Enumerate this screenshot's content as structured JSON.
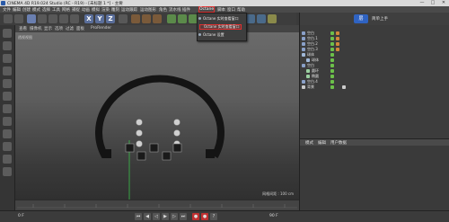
{
  "window": {
    "title": "CINEMA 4D R19.024 Studio (RC - R19) - [未标题 1 *] - 主要",
    "buttons": [
      "—",
      "□",
      "✕"
    ]
  },
  "menubar": {
    "items": [
      "文件",
      "编辑",
      "创建",
      "模式",
      "选择",
      "工具",
      "网格",
      "捕捉",
      "动画",
      "模拟",
      "渲染",
      "雕刻",
      "运动跟踪",
      "运动图形",
      "角色",
      "流水线",
      "插件",
      "Octane",
      "脚本",
      "窗口",
      "帮助"
    ]
  },
  "toolbar": {
    "xyz": [
      "X",
      "Y",
      "Z"
    ]
  },
  "dropdown": {
    "items": [
      "Octane 实时查看窗口",
      "Octane 实时查看窗口",
      "Octane 设置"
    ]
  },
  "viewport": {
    "menu": [
      "查看",
      "摄像机",
      "显示",
      "选项",
      "过滤",
      "面板",
      "ProRender"
    ],
    "label": "透视视图",
    "grid_scale": "网格间距 : 100 cm"
  },
  "right_panel": {
    "logo": "层",
    "header_text": "简单上手",
    "objects": [
      {
        "name": "空白",
        "indent": 0
      },
      {
        "name": "空白.1",
        "indent": 0
      },
      {
        "name": "空白.2",
        "indent": 0
      },
      {
        "name": "空白.3",
        "indent": 0
      },
      {
        "name": "球体",
        "indent": 0
      },
      {
        "name": "球体",
        "indent": 1
      },
      {
        "name": "空白",
        "indent": 0
      },
      {
        "name": "圆环",
        "indent": 1
      },
      {
        "name": "椭圆",
        "indent": 1
      },
      {
        "name": "空白.4",
        "indent": 0
      },
      {
        "name": "背景",
        "indent": 0
      }
    ],
    "attr_tabs": [
      "模式",
      "编辑",
      "用户数据"
    ]
  },
  "timeline": {
    "frame": "0 F",
    "end": "90 F"
  },
  "colors": {
    "accent": "#e03030",
    "octane_blue": "#2f63c2"
  }
}
